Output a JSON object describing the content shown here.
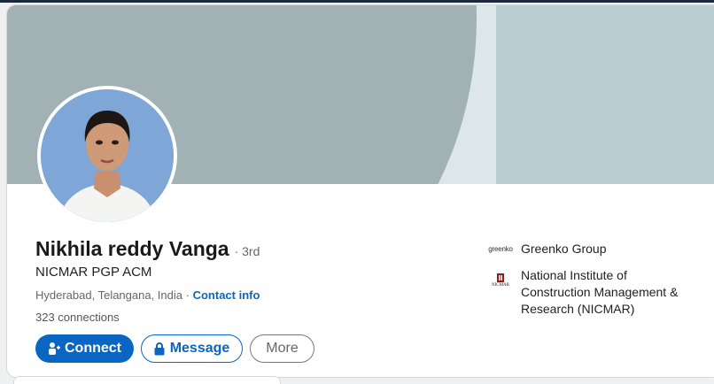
{
  "profile": {
    "name": "Nikhila reddy Vanga",
    "degree": "· 3rd",
    "headline": "NICMAR PGP ACM",
    "location": "Hyderabad, Telangana, India",
    "separator": "·",
    "contact_info": "Contact info",
    "connections": "323 connections"
  },
  "actions": {
    "connect_label": "Connect",
    "message_label": "Message",
    "more_label": "More"
  },
  "organizations": [
    {
      "logo_text": "greenko",
      "name": "Greenko Group",
      "logo_icon": "greenko-logo-icon"
    },
    {
      "logo_text": "NICMAR",
      "name": "National Institute of Construction Management & Research (NICMAR)",
      "logo_icon": "nicmar-logo-icon"
    }
  ],
  "colors": {
    "brand_blue": "#0a66c2",
    "banner_light": "#dde6e8",
    "banner_dark": "#a1b1b4",
    "banner_right": "#b9cdd2"
  }
}
